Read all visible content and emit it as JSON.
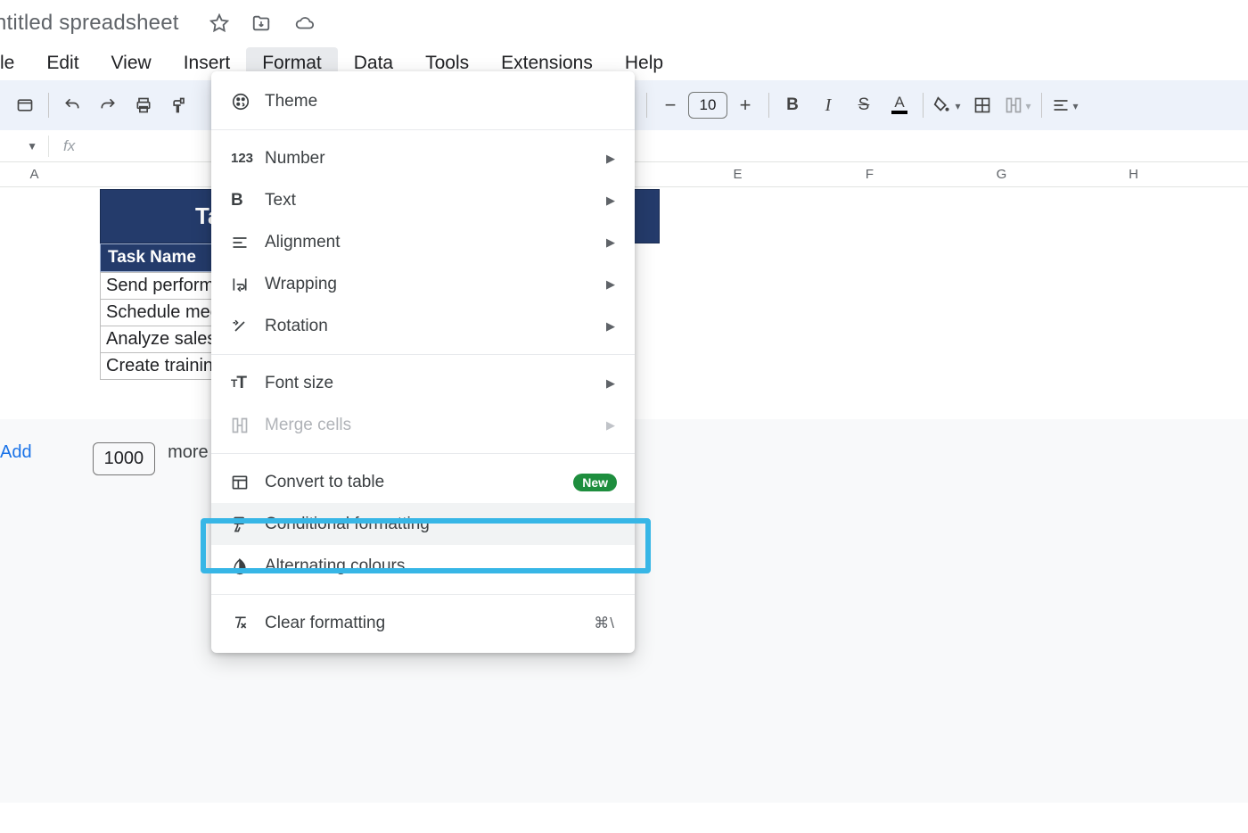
{
  "doc_title": "ntitled spreadsheet",
  "menubar": {
    "file": "le",
    "edit": "Edit",
    "view": "View",
    "insert": "Insert",
    "format": "Format",
    "data": "Data",
    "tools": "Tools",
    "extensions": "Extensions",
    "help": "Help"
  },
  "toolbar": {
    "font_size": "10"
  },
  "columns": {
    "a": "A",
    "e": "E",
    "f": "F",
    "g": "G",
    "h": "H"
  },
  "sheet": {
    "title_cell": "Ta",
    "header1": "Task Name",
    "rows": [
      "Send performa",
      "Schedule mee",
      "Analyze sales",
      "Create training"
    ]
  },
  "footer": {
    "add": "Add",
    "count": "1000",
    "more": "more r"
  },
  "format_menu": {
    "theme": "Theme",
    "number": "Number",
    "text": "Text",
    "alignment": "Alignment",
    "wrapping": "Wrapping",
    "rotation": "Rotation",
    "font_size": "Font size",
    "merge_cells": "Merge cells",
    "convert_table": "Convert to table",
    "convert_table_badge": "New",
    "conditional_formatting": "Conditional formatting",
    "alternating_colours": "Alternating colours",
    "clear_formatting": "Clear formatting",
    "clear_formatting_shortcut": "⌘\\"
  }
}
